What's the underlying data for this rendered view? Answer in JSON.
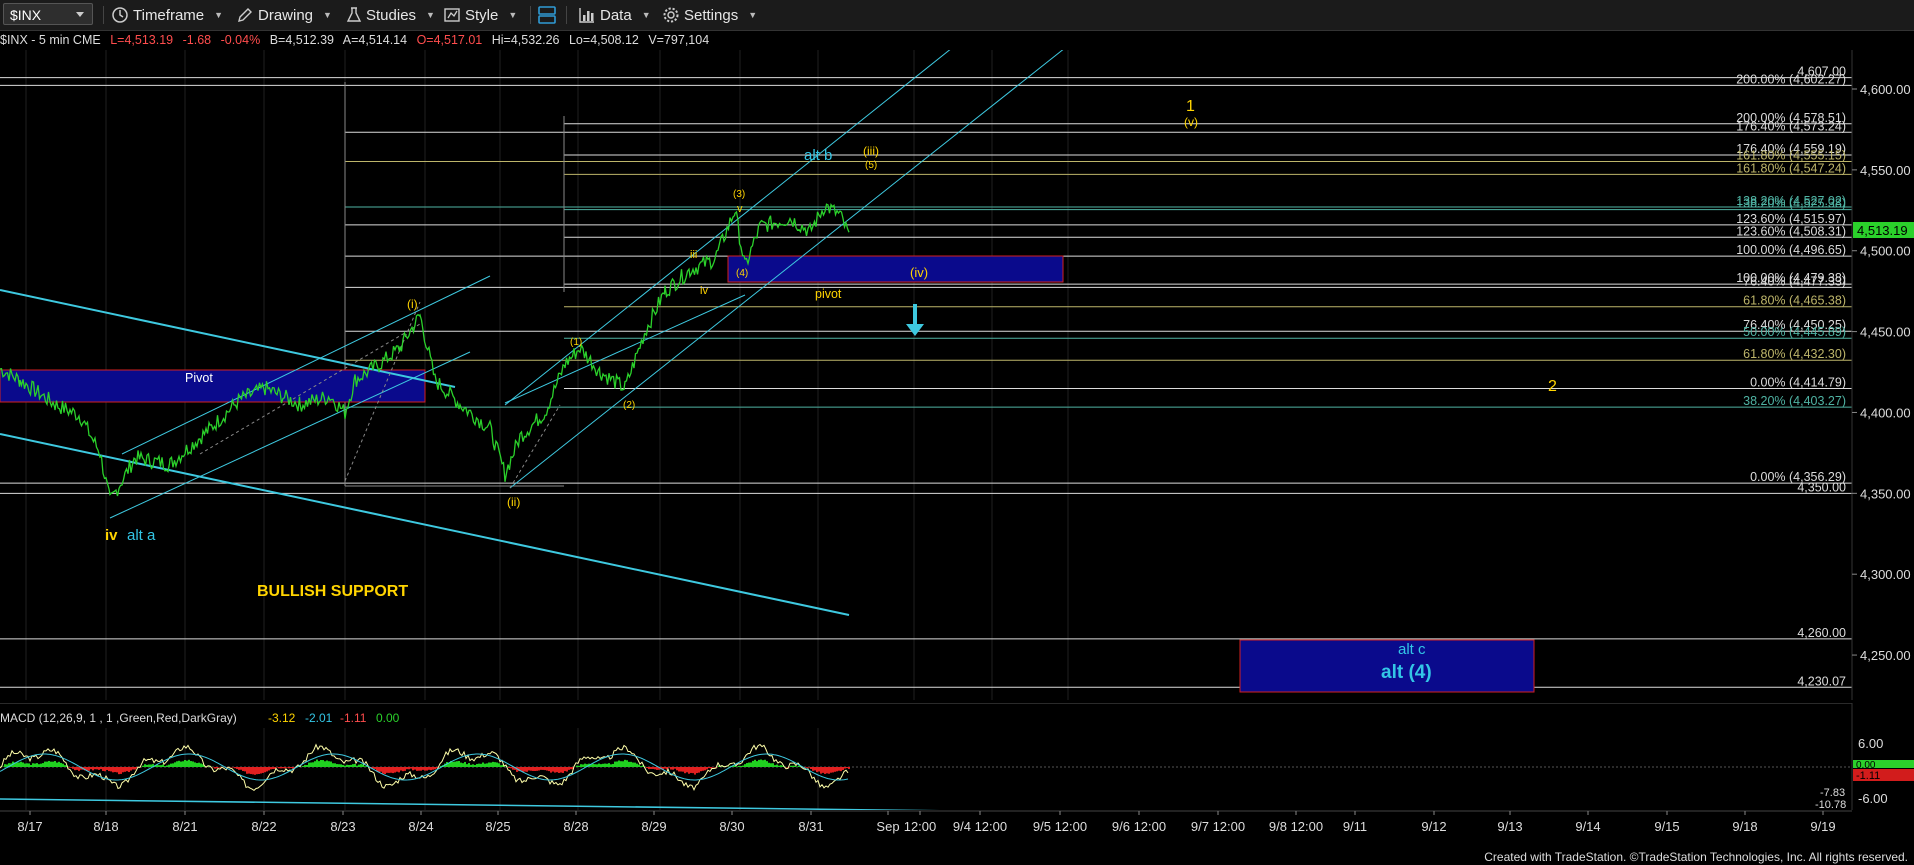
{
  "toolbar": {
    "symbol": "$INX",
    "timeframe": "Timeframe",
    "drawing": "Drawing",
    "studies": "Studies",
    "style": "Style",
    "data": "Data",
    "settings": "Settings"
  },
  "stats": {
    "symbol_line": "$INX - 5 min  CME",
    "last": "L=4,513.19",
    "change": "-1.68",
    "change_pct": "-0.04%",
    "bid": "B=4,512.39",
    "ask": "A=4,514.14",
    "open": "O=4,517.01",
    "high": "Hi=4,532.26",
    "low": "Lo=4,508.12",
    "volume": "V=797,104"
  },
  "colors": {
    "price": "#2bd12b",
    "channel": "#3ec9e0",
    "fib_white": "#dcdcdc",
    "fib_olive": "#bdb56a",
    "fib_teal": "#4fb3a3",
    "box_fill": "#0a0a8c",
    "box_border": "#d22020",
    "wave_yellow": "#ffd400",
    "wave_cyan": "#33c6e6",
    "last_price_tag": "#2bd12b"
  },
  "price_axis": {
    "labels": [
      "4,600.00",
      "4,550.00",
      "4,500.00",
      "4,450.00",
      "4,400.00",
      "4,350.00",
      "4,300.00",
      "4,250.00"
    ],
    "last_price": "4,513.19",
    "range": [
      4185,
      4620
    ]
  },
  "fib_levels": [
    {
      "label": "4,607.00",
      "value": 4607,
      "color": "fib_white"
    },
    {
      "label": "200.00% (4,602.27)",
      "value": 4602.27,
      "color": "fib_white"
    },
    {
      "label": "200.00% (4,578.51)",
      "value": 4578.51,
      "color": "fib_white"
    },
    {
      "label": "176.40% (4,573.24)",
      "value": 4573.24,
      "color": "fib_white"
    },
    {
      "label": "176.40% (4,559.19)",
      "value": 4559.19,
      "color": "fib_white"
    },
    {
      "label": "161.80% (4,555.15)",
      "value": 4555.15,
      "color": "fib_olive"
    },
    {
      "label": "161.80% (4,547.24)",
      "value": 4547.24,
      "color": "fib_olive"
    },
    {
      "label": "138.20% (4,527.02)",
      "value": 4527.02,
      "color": "fib_teal"
    },
    {
      "label": "138.20% (4,525.38)",
      "value": 4525.38,
      "color": "fib_teal"
    },
    {
      "label": "123.60% (4,515.97)",
      "value": 4515.97,
      "color": "fib_white"
    },
    {
      "label": "123.60% (4,508.31)",
      "value": 4508.31,
      "color": "fib_white"
    },
    {
      "label": "100.00% (4,496.65)",
      "value": 4496.65,
      "color": "fib_white"
    },
    {
      "label": "100.00% (4,479.38)",
      "value": 4479.38,
      "color": "fib_white"
    },
    {
      "label": "76.40% (4,477.33)",
      "value": 4477.33,
      "color": "fib_white"
    },
    {
      "label": "61.80% (4,465.38)",
      "value": 4465.38,
      "color": "fib_olive"
    },
    {
      "label": "76.40% (4,450.25)",
      "value": 4450.25,
      "color": "fib_white"
    },
    {
      "label": "50.00% (4,445.89)",
      "value": 4445.89,
      "color": "fib_teal"
    },
    {
      "label": "61.80% (4,432.30)",
      "value": 4432.3,
      "color": "fib_olive"
    },
    {
      "label": "0.00% (4,414.79)",
      "value": 4414.79,
      "color": "fib_white"
    },
    {
      "label": "38.20% (4,403.27)",
      "value": 4403.27,
      "color": "fib_teal"
    },
    {
      "label": "0.00% (4,356.29)",
      "value": 4356.29,
      "color": "fib_white"
    },
    {
      "label": "4,350.00",
      "value": 4350,
      "color": "fib_white"
    },
    {
      "label": "4,260.00",
      "value": 4260,
      "color": "fib_white"
    },
    {
      "label": "4,230.07",
      "value": 4230.07,
      "color": "fib_white"
    }
  ],
  "annotations": {
    "pivot_left": "Pivot",
    "pivot_right": "pivot",
    "bullish_support": "BULLISH SUPPORT",
    "wave_iv": "iv",
    "alt_a": "alt a",
    "wave_i": "(i)",
    "wave_ii": "(ii)",
    "wave_1_small": "(1)",
    "wave_2_small": "(2)",
    "wave_3_small": "(3)",
    "wave_4_small": "(4)",
    "wave_5_small": "(5)",
    "wave_iii_small": "iii",
    "wave_iv_small": "iv",
    "wave_v_small": "v",
    "wave_iii_paren": "(iii)",
    "wave_iv_paren": "(iv)",
    "wave_v_paren": "(v)",
    "alt_b": "alt b",
    "wave_1_big": "1",
    "wave_2_big": "2",
    "alt_c": "alt c",
    "alt_4": "alt (4)"
  },
  "macd": {
    "title": "MACD (12,26,9, 1 , 1 ,Green,Red,DarkGray)",
    "v1": "-3.12",
    "v2": "-2.01",
    "v3": "-1.11",
    "v4": "0.00",
    "axis_labels": [
      "6.00",
      "-6.00"
    ],
    "tags": [
      "0.00",
      "-1.11"
    ],
    "lows": [
      "-7.83",
      "-10.78"
    ]
  },
  "x_axis": {
    "labels": [
      "8/17",
      "8/18",
      "8/21",
      "8/22",
      "8/23",
      "8/24",
      "8/25",
      "8/28",
      "8/29",
      "8/30",
      "8/31",
      "Sep",
      "12:00",
      "9/4 12:00",
      "9/5 12:00",
      "9/6 12:00",
      "9/7 12:00",
      "9/8 12:00",
      "9/11",
      "9/12",
      "9/13",
      "9/14",
      "9/15",
      "9/18",
      "9/19"
    ]
  },
  "footer": "Created with TradeStation. ©TradeStation Technologies, Inc. All rights reserved."
}
